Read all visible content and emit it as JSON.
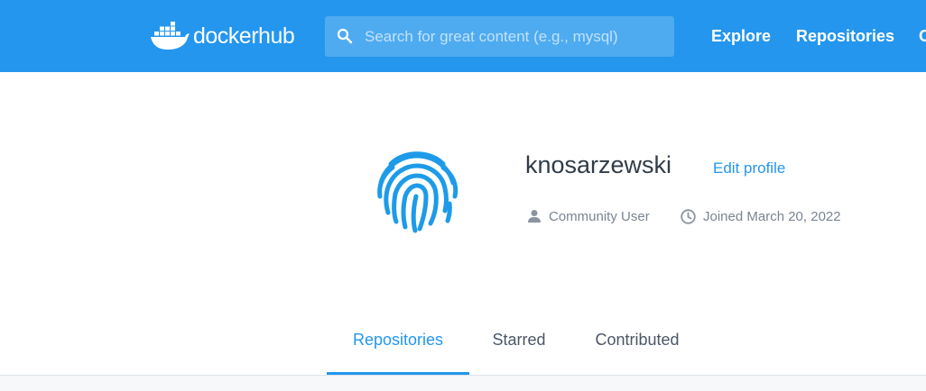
{
  "header": {
    "logo_text_docker": "docker",
    "logo_text_hub": "hub",
    "search_placeholder": "Search for great content (e.g., mysql)",
    "nav": {
      "explore": "Explore",
      "repositories": "Repositories",
      "more": "O"
    }
  },
  "profile": {
    "username": "knosarzewski",
    "edit_profile": "Edit profile",
    "role": "Community User",
    "joined": "Joined March 20, 2022"
  },
  "tabs": [
    {
      "label": "Repositories",
      "active": true
    },
    {
      "label": "Starred",
      "active": false
    },
    {
      "label": "Contributed",
      "active": false
    }
  ],
  "colors": {
    "brand": "#2496ed",
    "text_dark": "#313c48",
    "text_muted": "#7a8591"
  },
  "icons": {
    "logo": "docker-whale-icon",
    "search": "search-icon",
    "avatar": "fingerprint-icon",
    "role": "person-icon",
    "joined": "clock-icon"
  }
}
